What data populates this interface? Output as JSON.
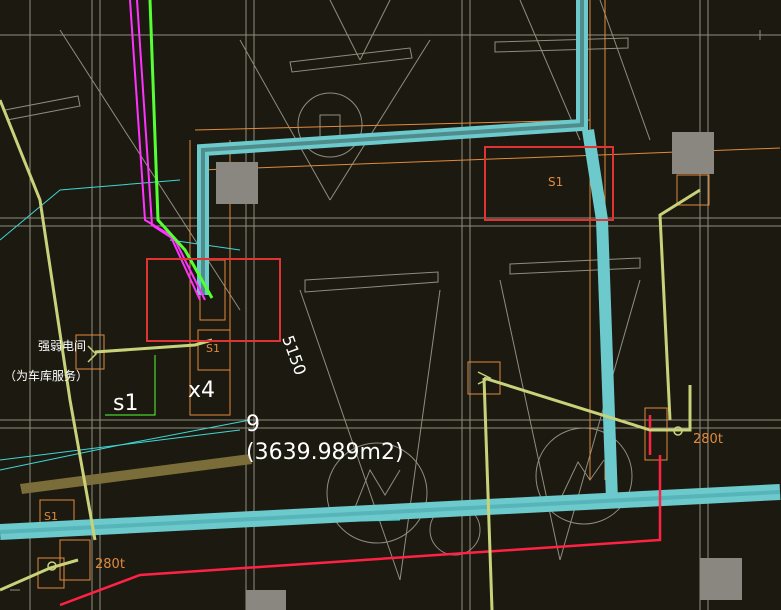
{
  "drawing": {
    "background": "#1c1a10",
    "colors": {
      "cyan_duct": "#6cc9cc",
      "cyan_thin": "#3fd6d6",
      "magenta": "#ff33ff",
      "green": "#55ff33",
      "red": "#ff2244",
      "highlight_red": "#e03333",
      "yellow_green": "#c8d27a",
      "orange": "#e08a3c",
      "gray_line": "#8f8c80",
      "column_gray": "#8a8780",
      "white_text": "#ffffff"
    },
    "area_label": {
      "number": "9",
      "area": "(3639.989m2)"
    },
    "room_note": {
      "line1": "强弱电间",
      "line2": "（为车库服务）"
    },
    "labels": {
      "s1_left": "s1",
      "x4": "x4",
      "dim_5150": "5150",
      "s1_box_top": "S1",
      "s1_box_mid": "S1",
      "s1_box_bottom": "S1",
      "tag_280_right": "280t",
      "tag_280_left": "280t"
    }
  }
}
